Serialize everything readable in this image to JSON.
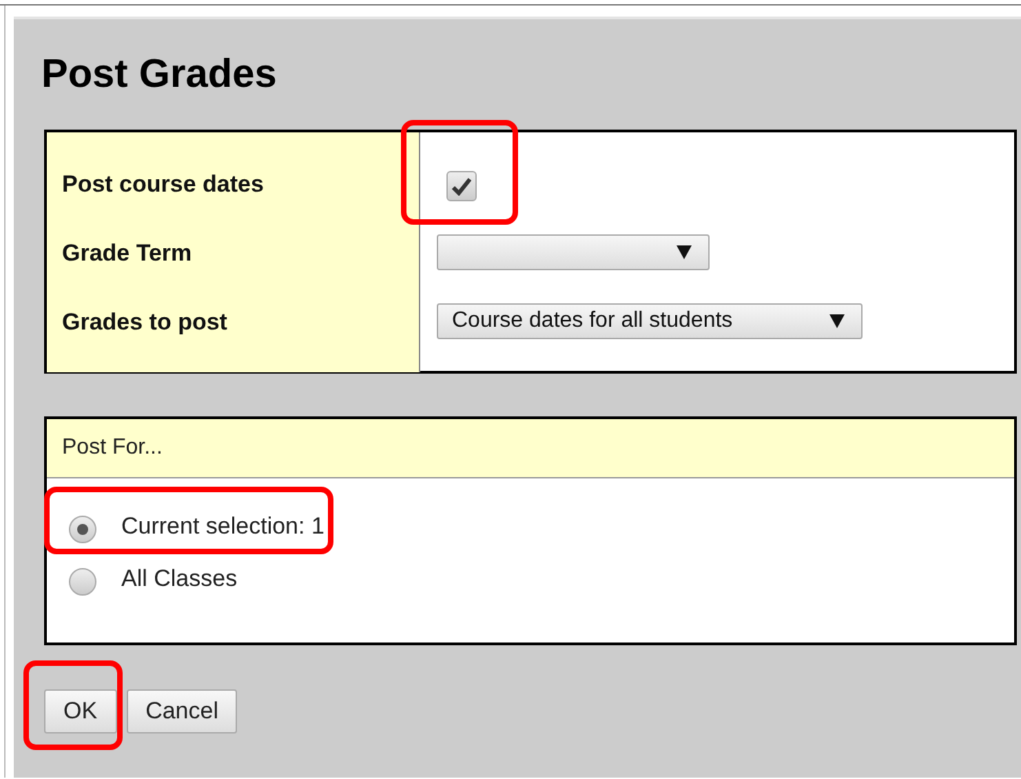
{
  "title": "Post Grades",
  "fields": [
    {
      "kind": "checkbox",
      "label": "Post course dates",
      "checked": true,
      "highlighted": true
    },
    {
      "kind": "select",
      "label": "Grade Term",
      "highlighted": false
    },
    {
      "kind": "select",
      "label": "Grades to post",
      "value": "Course dates for all students",
      "highlighted": false
    }
  ],
  "post_for": {
    "header": "Post For...",
    "options": [
      {
        "label": "Current selection: 1",
        "selected": true,
        "highlighted": true
      },
      {
        "label": "All Classes",
        "selected": false,
        "highlighted": false
      }
    ]
  },
  "buttons": [
    {
      "label": "OK",
      "highlighted": true
    },
    {
      "label": "Cancel",
      "highlighted": false
    }
  ]
}
